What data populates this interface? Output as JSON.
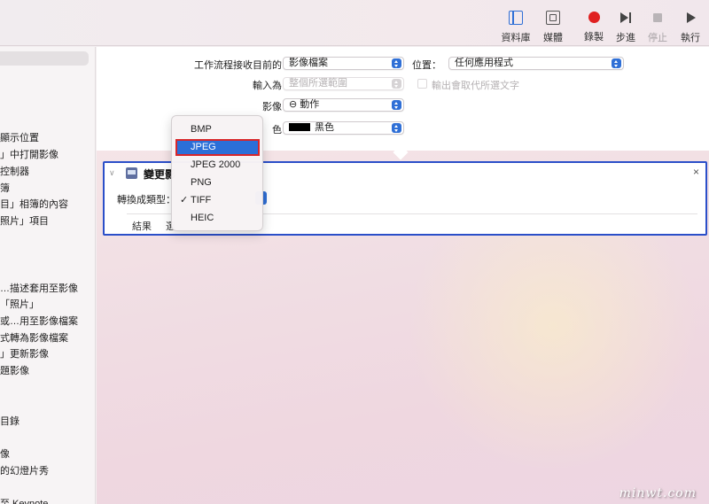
{
  "toolbar": {
    "library": "資料庫",
    "media": "媒體",
    "record": "錄製",
    "step": "步進",
    "stop": "停止",
    "run": "執行",
    "record_color": "#e02020",
    "accent_color": "#2f6fd6"
  },
  "sidebar": {
    "items": [
      "顯示位置",
      "」中打開影像",
      "控制器",
      "簿",
      "目」相簿的內容",
      "照片」項目",
      "…描述套用至影像",
      "「照片」",
      "或…用至影像檔案",
      "式轉為影像檔案",
      "」更新影像",
      "題影像",
      "目錄",
      "像",
      "的幻燈片秀",
      "至 Keynote"
    ]
  },
  "workflow": {
    "receives_label": "工作流程接收目前的",
    "receives_value": "影像檔案",
    "location_label": "位置：",
    "location_value": "任何應用程式",
    "input_label": "輸入為",
    "input_value": "整個所選範圍",
    "output_replaces": "輸出會取代所選文字",
    "image_label": "影像",
    "image_value": "⊖ 動作",
    "color_label": "色",
    "color_value": "黑色"
  },
  "action": {
    "title": "變更影",
    "convert_label": "轉換成類型：",
    "tab_results": "結果",
    "tab_options": "選",
    "close": "×",
    "chevron": "∨"
  },
  "menu": {
    "items": [
      "BMP",
      "JPEG",
      "JPEG 2000",
      "PNG",
      "TIFF",
      "HEIC"
    ],
    "highlighted": "JPEG",
    "checked": "TIFF",
    "checkmark": "✓",
    "highlight_color": "#2b6fd8",
    "outline_color": "#d8262a"
  },
  "watermark": "minwt.com"
}
